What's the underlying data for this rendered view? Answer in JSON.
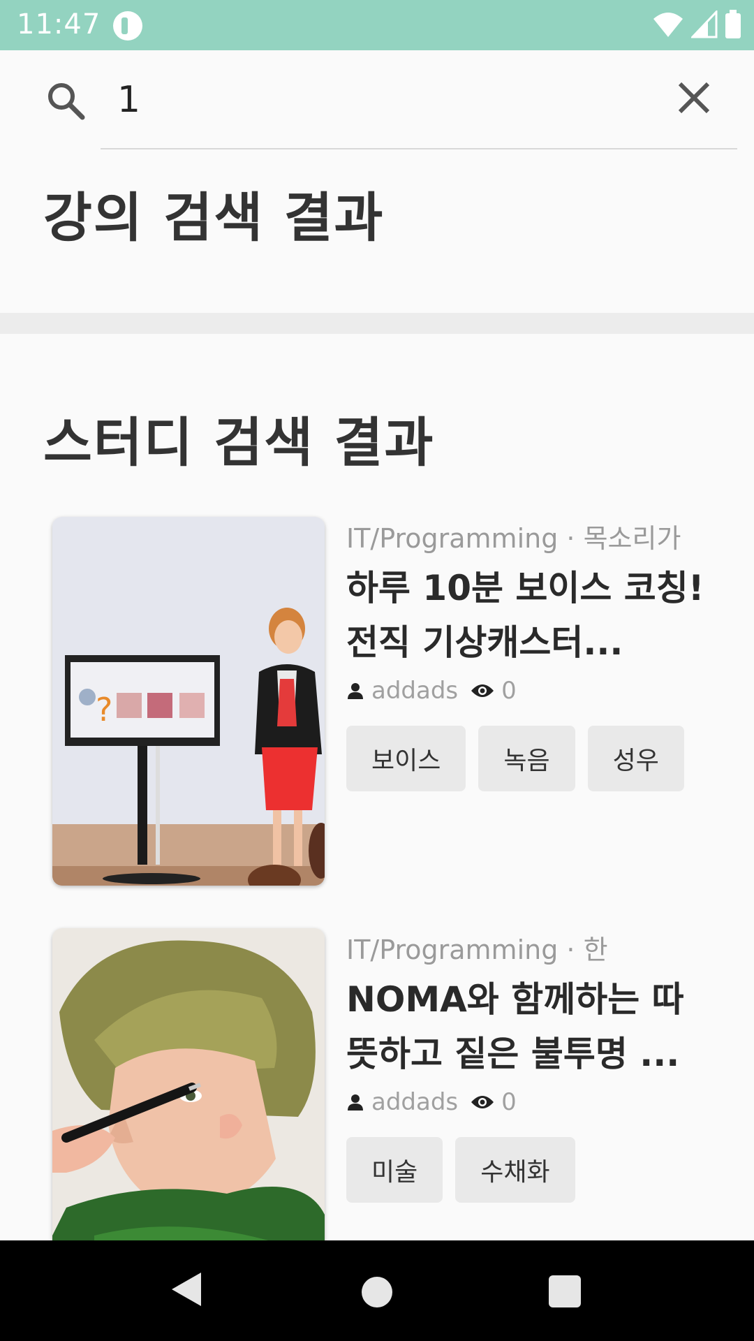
{
  "status_bar": {
    "time": "11:47"
  },
  "search": {
    "query": "1",
    "placeholder": ""
  },
  "sections": {
    "lecture_title": "강의 검색 결과",
    "study_title": "스터디 검색 결과"
  },
  "study_results": [
    {
      "category": "IT/Programming · 목소리가",
      "title": "하루 10분 보이스 코칭! 전직 기상캐스터...",
      "author": "addads",
      "views": "0",
      "tags": [
        "보이스",
        "녹음",
        "성우"
      ]
    },
    {
      "category": "IT/Programming · 한",
      "title": "NOMA와 함께하는 따뜻하고 짙은 불투명 ...",
      "author": "addads",
      "views": "0",
      "tags": [
        "미술",
        "수채화"
      ]
    }
  ]
}
